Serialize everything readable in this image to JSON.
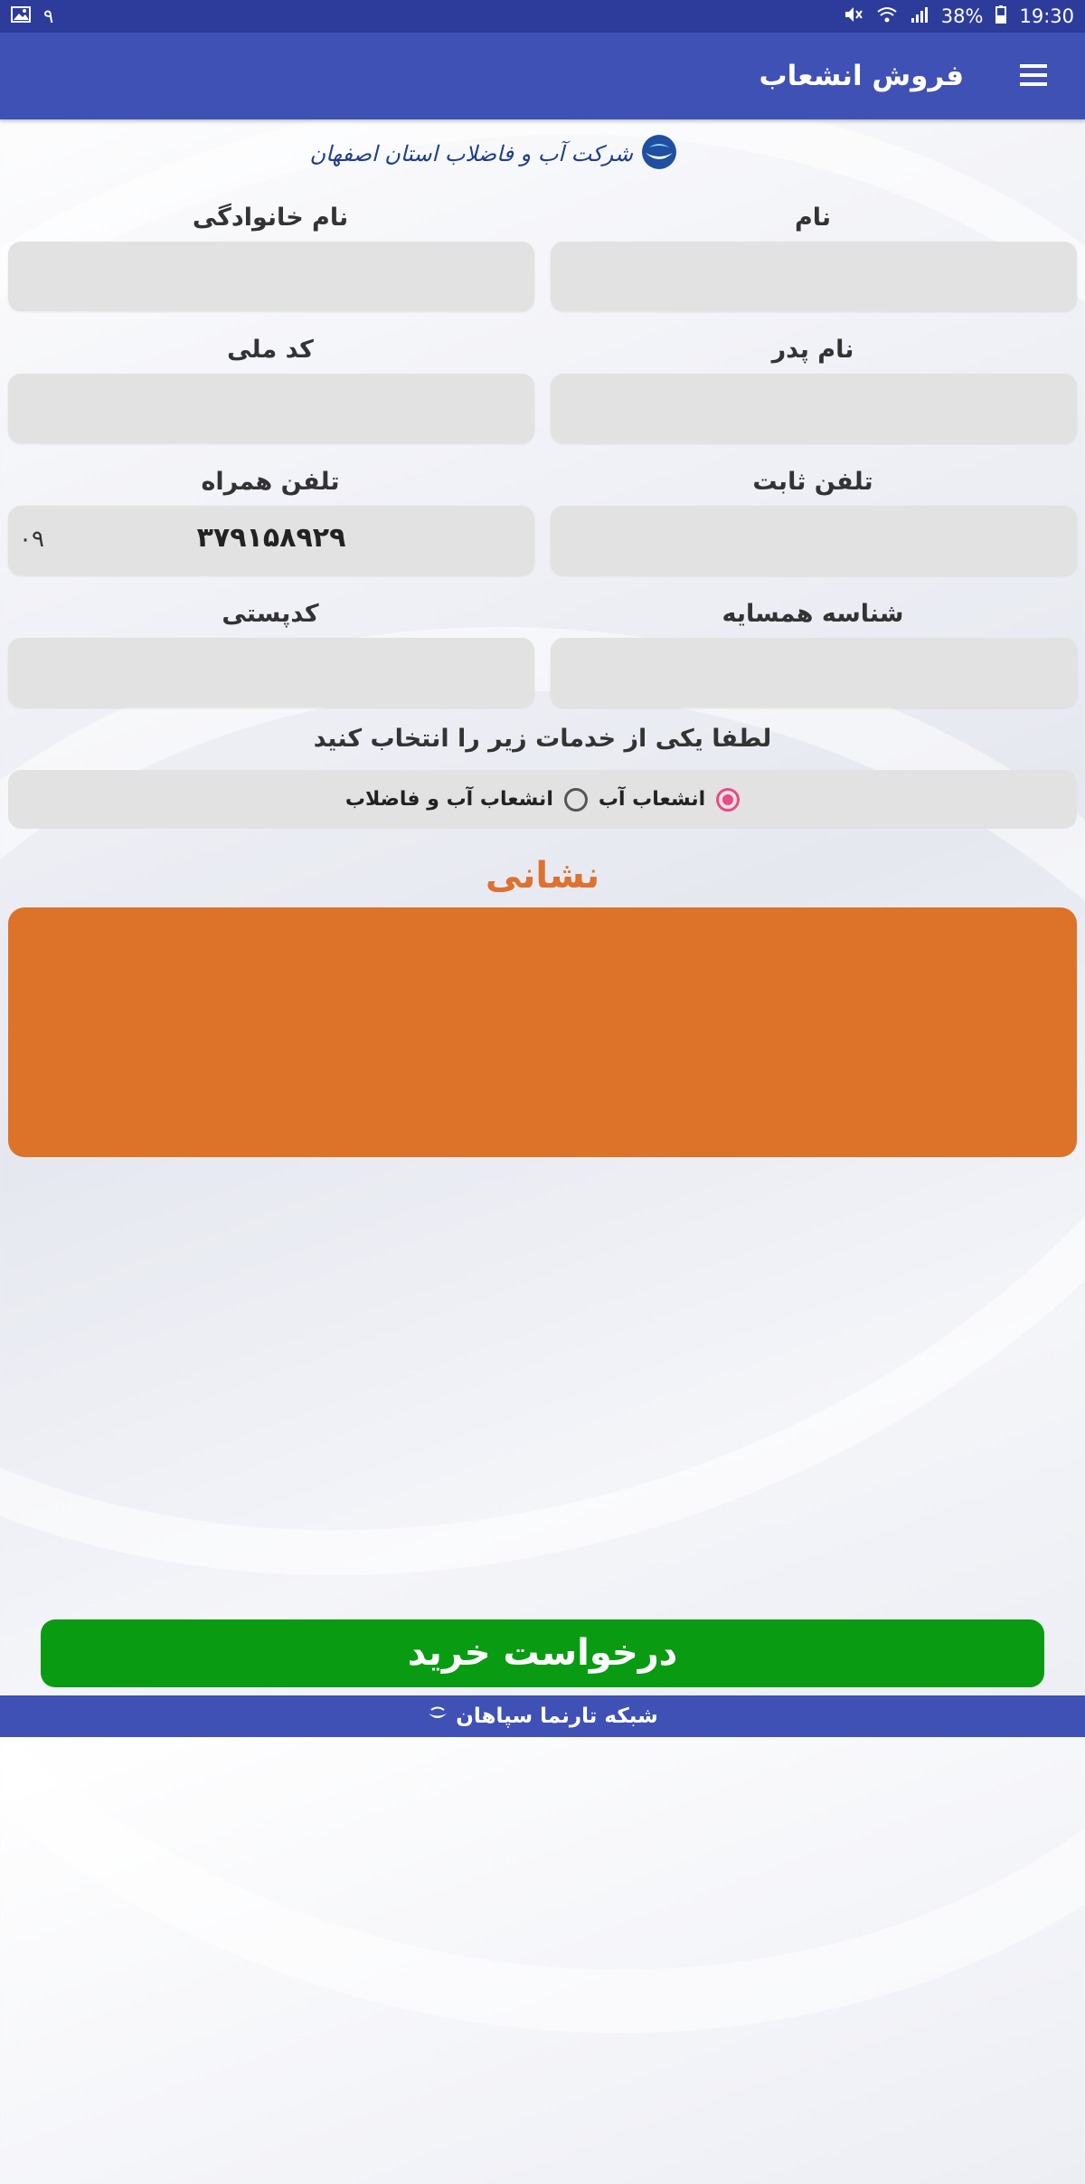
{
  "status_bar": {
    "notification_count": "۹",
    "battery": "38%",
    "time": "19:30",
    "icons": [
      "image-icon",
      "mute-icon",
      "wifi-icon",
      "signal-icon",
      "battery-icon"
    ]
  },
  "app_bar": {
    "title": "فروش انشعاب",
    "menu_icon": "hamburger-menu-icon"
  },
  "logo": {
    "text": "شرکت آب و فاضلاب استان اصفهان",
    "icon": "water-company-logo-icon"
  },
  "form": {
    "first_name_label": "نام",
    "last_name_label": "نام خانوادگی",
    "father_name_label": "نام پدر",
    "national_code_label": "کد ملی",
    "landline_label": "تلفن ثابت",
    "mobile_label": "تلفن همراه",
    "mobile_prefix": "۰۹",
    "mobile_value": "۳۷۹۱۵۸۹۲۹",
    "neighbor_id_label": "شناسه همسایه",
    "postal_code_label": "کدپستی"
  },
  "services": {
    "prompt": "لطفا یکی از خدمات زیر را انتخاب کنید",
    "options": [
      "انشعاب آب",
      "انشعاب آب و فاضلاب"
    ],
    "selected": "انشعاب آب"
  },
  "address": {
    "title": "نشانی",
    "value": ""
  },
  "submit_label": "درخواست خرید",
  "footer_text": "شبکه تارنما سپاهان",
  "colors": {
    "status_bar": "#2d3c9a",
    "app_bar": "#3f51b5",
    "accent_orange": "#dd7229",
    "submit_green": "#099c12",
    "radio_pink": "#e94b86"
  }
}
